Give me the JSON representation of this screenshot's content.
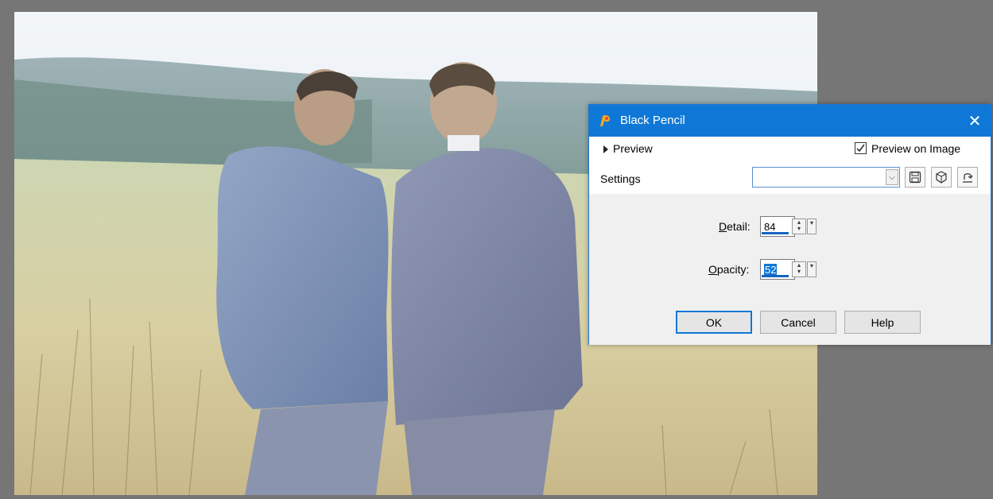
{
  "dialog": {
    "title": "Black Pencil",
    "close_glyph": "✕",
    "preview_label": "Preview",
    "preview_on_image_label": "Preview on Image",
    "preview_on_image_checked": true,
    "settings_label": "Settings",
    "settings_value": "",
    "detail": {
      "label_mnemonic": "D",
      "label_rest": "etail:",
      "value": "84"
    },
    "opacity": {
      "label_mnemonic": "O",
      "label_rest": "pacity:",
      "value": "52"
    },
    "buttons": {
      "ok": "OK",
      "cancel": "Cancel",
      "help": "Help"
    },
    "icons": [
      "save-preset-icon",
      "resource-icon",
      "reset-icon"
    ]
  },
  "colors": {
    "titlebar": "#0f78d6",
    "workspace": "#767676",
    "dialog_body": "#f0f0f0"
  }
}
